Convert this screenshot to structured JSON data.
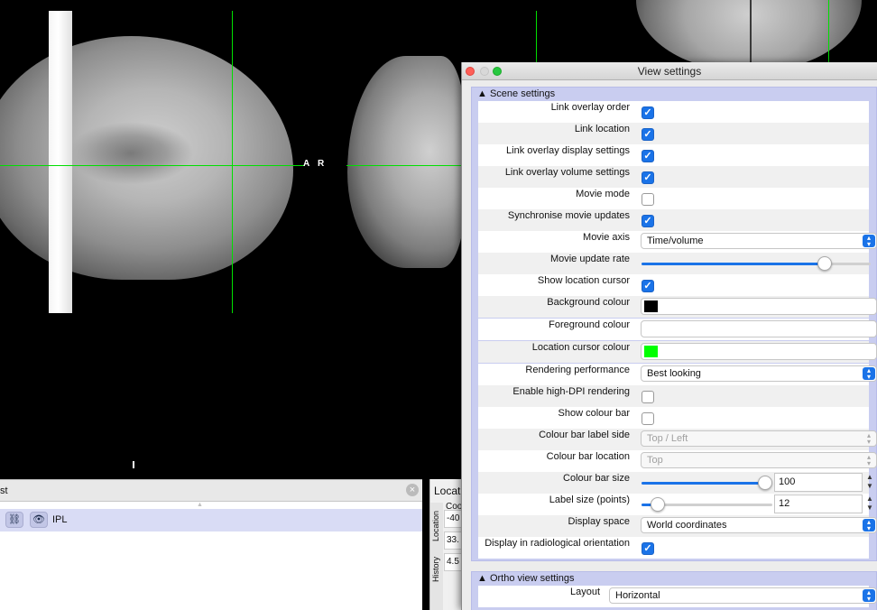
{
  "viewer": {
    "sagittal_orientation": {
      "anterior": "A"
    },
    "coronal_orientation": {
      "right": "R"
    },
    "cursor_color": "#00e000"
  },
  "overlay_list": {
    "title": "st",
    "overlays": [
      {
        "name": "IPL",
        "link_icon": "link-icon",
        "visibility_icon": "eye-icon"
      }
    ]
  },
  "location_panel": {
    "title": "Locati",
    "tabs": [
      "Location",
      "History"
    ],
    "header": "Coo",
    "values": [
      "-40",
      "33.",
      "4.5"
    ]
  },
  "view_settings": {
    "title": "View settings",
    "scene_section": {
      "title": "▲ Scene settings",
      "rows": [
        {
          "label": "Link overlay order",
          "type": "checkbox",
          "checked": true
        },
        {
          "label": "Link location",
          "type": "checkbox",
          "checked": true
        },
        {
          "label": "Link overlay display settings",
          "type": "checkbox",
          "checked": true
        },
        {
          "label": "Link overlay volume settings",
          "type": "checkbox",
          "checked": true
        },
        {
          "label": "Movie mode",
          "type": "checkbox",
          "checked": false
        },
        {
          "label": "Synchronise movie updates",
          "type": "checkbox",
          "checked": true
        },
        {
          "label": "Movie axis",
          "type": "select",
          "value": "Time/volume"
        },
        {
          "label": "Movie update rate",
          "type": "slider",
          "level": 0.87
        },
        {
          "label": "Show location cursor",
          "type": "checkbox",
          "checked": true
        },
        {
          "label": "Background colour",
          "type": "color",
          "color": "#000000"
        },
        {
          "label": "Foreground colour",
          "type": "color",
          "color": "#ffffff"
        },
        {
          "label": "Location cursor colour",
          "type": "color",
          "color": "#00ff00"
        },
        {
          "label": "Rendering performance",
          "type": "select",
          "value": "Best looking"
        },
        {
          "label": "Enable high-DPI rendering",
          "type": "checkbox",
          "checked": false
        },
        {
          "label": "Show colour bar",
          "type": "checkbox",
          "checked": false
        },
        {
          "label": "Colour bar label side",
          "type": "select",
          "value": "Top / Left",
          "disabled": true
        },
        {
          "label": "Colour bar location",
          "type": "select",
          "value": "Top",
          "disabled": true
        },
        {
          "label": "Colour bar size",
          "type": "spin-slider",
          "value": "100",
          "level": 1.0
        },
        {
          "label": "Label size (points)",
          "type": "spin-slider",
          "value": "12",
          "level": 0.1
        },
        {
          "label": "Display space",
          "type": "select",
          "value": "World coordinates"
        },
        {
          "label": "Display in radiological orientation",
          "type": "checkbox",
          "checked": true
        }
      ]
    },
    "ortho_section": {
      "title": "▲ Ortho view settings",
      "rows": [
        {
          "label": "Layout",
          "type": "select",
          "value": "Horizontal"
        }
      ]
    }
  }
}
